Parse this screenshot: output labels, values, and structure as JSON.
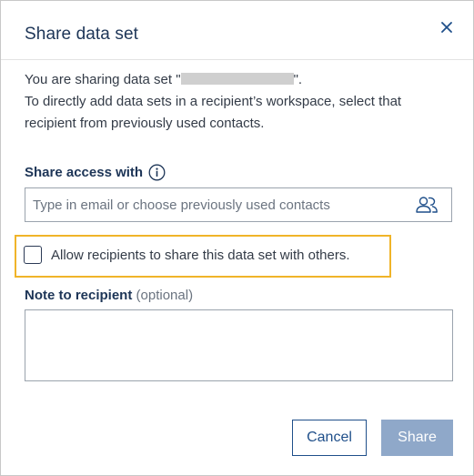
{
  "dialog": {
    "title": "Share data set",
    "intro_prefix": "You are sharing data set \"",
    "intro_suffix": "\".",
    "intro_line2": "To directly add data sets in a recipient’s workspace, select that recipient from previously used contacts."
  },
  "share_access": {
    "label": "Share access with",
    "placeholder": "Type in email or choose previously used contacts",
    "value": ""
  },
  "allow_reshare": {
    "label": "Allow recipients to share this data set with others.",
    "checked": false
  },
  "note": {
    "label": "Note to recipient",
    "optional": "(optional)",
    "value": ""
  },
  "buttons": {
    "cancel": "Cancel",
    "share": "Share"
  },
  "colors": {
    "highlight": "#f0b429",
    "primary": "#1f4f8a",
    "share_disabled": "#8fa8c9"
  },
  "icons": {
    "close": "close-icon",
    "info": "info-icon",
    "contacts": "contacts-icon"
  }
}
